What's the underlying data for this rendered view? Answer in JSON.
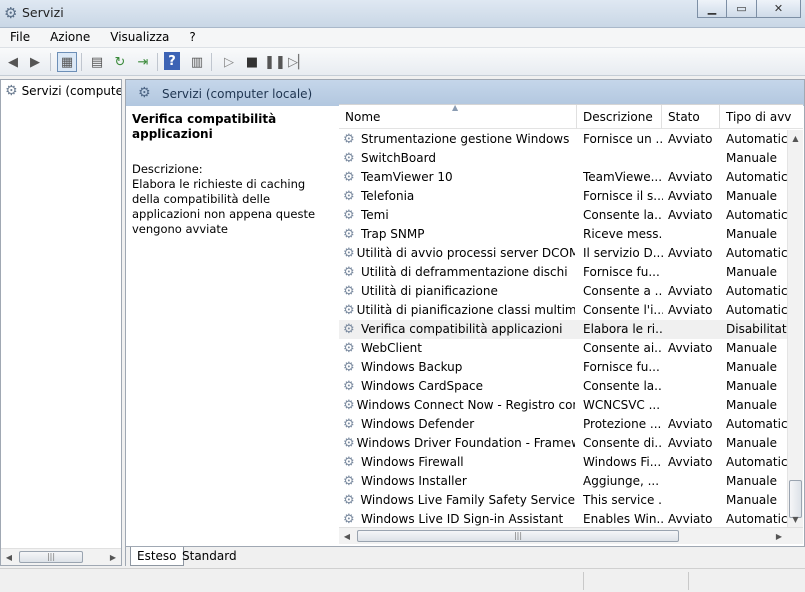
{
  "window": {
    "title": "Servizi",
    "app_icon": "gear-icon"
  },
  "menu": [
    "File",
    "Azione",
    "Visualizza",
    "?"
  ],
  "toolbar": {
    "icons": [
      "back-arrow-icon",
      "forward-arrow-icon",
      "show-hide-tree-icon",
      "properties-icon",
      "refresh-icon",
      "export-list-icon",
      "help-icon",
      "view-icon",
      "play-icon",
      "stop-icon",
      "pause-icon",
      "restart-icon"
    ]
  },
  "tree": {
    "root_label": "Servizi (computer"
  },
  "right_header": {
    "label": "Servizi (computer locale)"
  },
  "detail": {
    "title": "Verifica compatibilità applicazioni",
    "desc_label": "Descrizione:",
    "desc_text": "Elabora le richieste di caching della compatibilità delle applicazioni non appena queste vengono avviate"
  },
  "columns": {
    "name": "Nome",
    "desc": "Descrizione",
    "status": "Stato",
    "type": "Tipo di avv"
  },
  "services": [
    {
      "name": "Strumentazione gestione Windows",
      "desc": "Fornisce un ...",
      "status": "Avviato",
      "type": "Automatico"
    },
    {
      "name": "SwitchBoard",
      "desc": "",
      "status": "",
      "type": "Manuale"
    },
    {
      "name": "TeamViewer 10",
      "desc": "TeamViewe...",
      "status": "Avviato",
      "type": "Automatico"
    },
    {
      "name": "Telefonia",
      "desc": "Fornisce il s...",
      "status": "Avviato",
      "type": "Manuale"
    },
    {
      "name": "Temi",
      "desc": "Consente la...",
      "status": "Avviato",
      "type": "Automatico"
    },
    {
      "name": "Trap SNMP",
      "desc": "Riceve mess...",
      "status": "",
      "type": "Manuale"
    },
    {
      "name": "Utilità di avvio processi server DCOM",
      "desc": "Il servizio D...",
      "status": "Avviato",
      "type": "Automatico"
    },
    {
      "name": "Utilità di deframmentazione dischi",
      "desc": "Fornisce fu...",
      "status": "",
      "type": "Manuale"
    },
    {
      "name": "Utilità di pianificazione",
      "desc": "Consente a ...",
      "status": "Avviato",
      "type": "Automatico"
    },
    {
      "name": "Utilità di pianificazione classi multime...",
      "desc": "Consente l'i...",
      "status": "Avviato",
      "type": "Automatico"
    },
    {
      "name": "Verifica compatibilità applicazioni",
      "desc": "Elabora le ri...",
      "status": "",
      "type": "Disabilitato"
    },
    {
      "name": "WebClient",
      "desc": "Consente ai...",
      "status": "Avviato",
      "type": "Manuale"
    },
    {
      "name": "Windows Backup",
      "desc": "Fornisce fu...",
      "status": "",
      "type": "Manuale"
    },
    {
      "name": "Windows CardSpace",
      "desc": "Consente la...",
      "status": "",
      "type": "Manuale"
    },
    {
      "name": "Windows Connect Now - Registro con...",
      "desc": "WCNCSVC ...",
      "status": "",
      "type": "Manuale"
    },
    {
      "name": "Windows Defender",
      "desc": "Protezione ...",
      "status": "Avviato",
      "type": "Automatico"
    },
    {
      "name": "Windows Driver Foundation - Framew...",
      "desc": "Consente di...",
      "status": "Avviato",
      "type": "Manuale"
    },
    {
      "name": "Windows Firewall",
      "desc": "Windows Fi...",
      "status": "Avviato",
      "type": "Automatico"
    },
    {
      "name": "Windows Installer",
      "desc": "Aggiunge, ...",
      "status": "",
      "type": "Manuale"
    },
    {
      "name": "Windows Live Family Safety Service",
      "desc": "This service ...",
      "status": "",
      "type": "Manuale"
    },
    {
      "name": "Windows Live ID Sign-in Assistant",
      "desc": "Enables Win...",
      "status": "Avviato",
      "type": "Automatico"
    }
  ],
  "selected_index": 10,
  "tabs": [
    "Esteso",
    "Standard"
  ],
  "active_tab": "Esteso"
}
